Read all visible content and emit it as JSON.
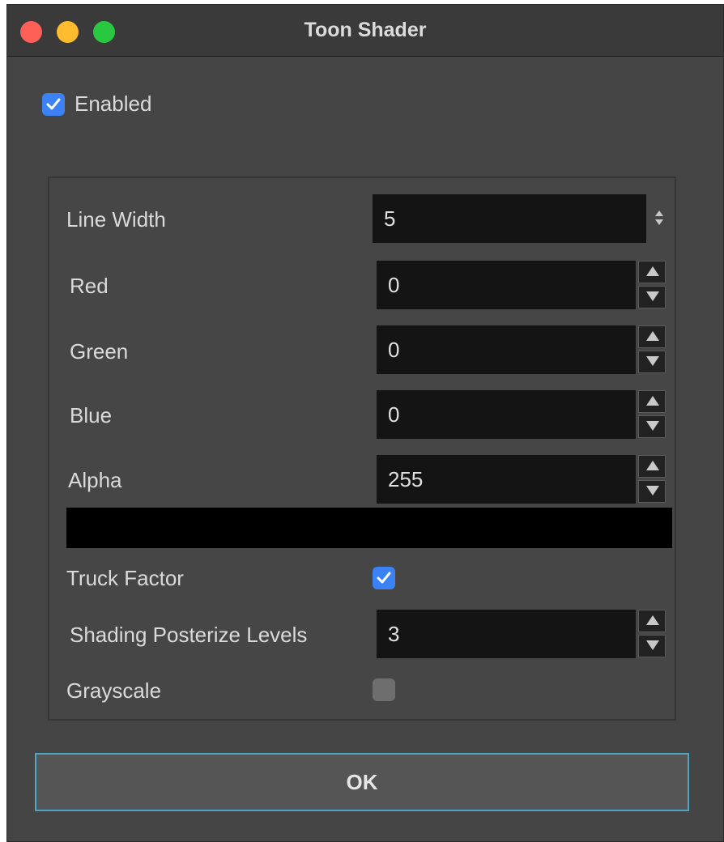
{
  "window": {
    "title": "Toon Shader"
  },
  "enabled": {
    "label": "Enabled",
    "checked": true
  },
  "line_width": {
    "label": "Line Width",
    "value": "5"
  },
  "red": {
    "label": "Red",
    "value": "0"
  },
  "green": {
    "label": "Green",
    "value": "0"
  },
  "blue": {
    "label": "Blue",
    "value": "0"
  },
  "alpha": {
    "label": "Alpha",
    "value": "255"
  },
  "color_preview": {
    "color": "#000000"
  },
  "truck_factor": {
    "label": "Truck Factor",
    "checked": true
  },
  "posterize": {
    "label": "Shading Posterize Levels",
    "value": "3"
  },
  "grayscale": {
    "label": "Grayscale",
    "checked": false
  },
  "ok_button": {
    "label": "OK"
  },
  "colors": {
    "accent": "#3b82f6",
    "focus_ring": "#4fa6c4"
  }
}
